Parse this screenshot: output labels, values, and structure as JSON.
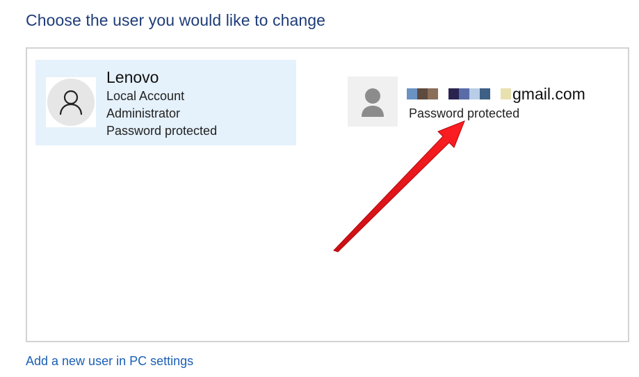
{
  "header": {
    "title": "Choose the user you would like to change"
  },
  "users": [
    {
      "name": "Lenovo",
      "account_type": "Local Account",
      "role": "Administrator",
      "status": "Password protected"
    },
    {
      "email_suffix": "gmail.com",
      "status": "Password protected"
    }
  ],
  "footer": {
    "add_user_link": "Add a new user in PC settings"
  },
  "colors": {
    "title": "#1e3c78",
    "selected_tile": "#e5f1fb",
    "link": "#1a5fb4",
    "arrow": "#e8141b",
    "redaction_blocks": [
      "#6a93c4",
      "#5e4a3e",
      "#8a6e58",
      "#2a2350",
      "#5a6ca8",
      "#b8cde6",
      "#3e5f86",
      "#e9e0b0"
    ]
  }
}
